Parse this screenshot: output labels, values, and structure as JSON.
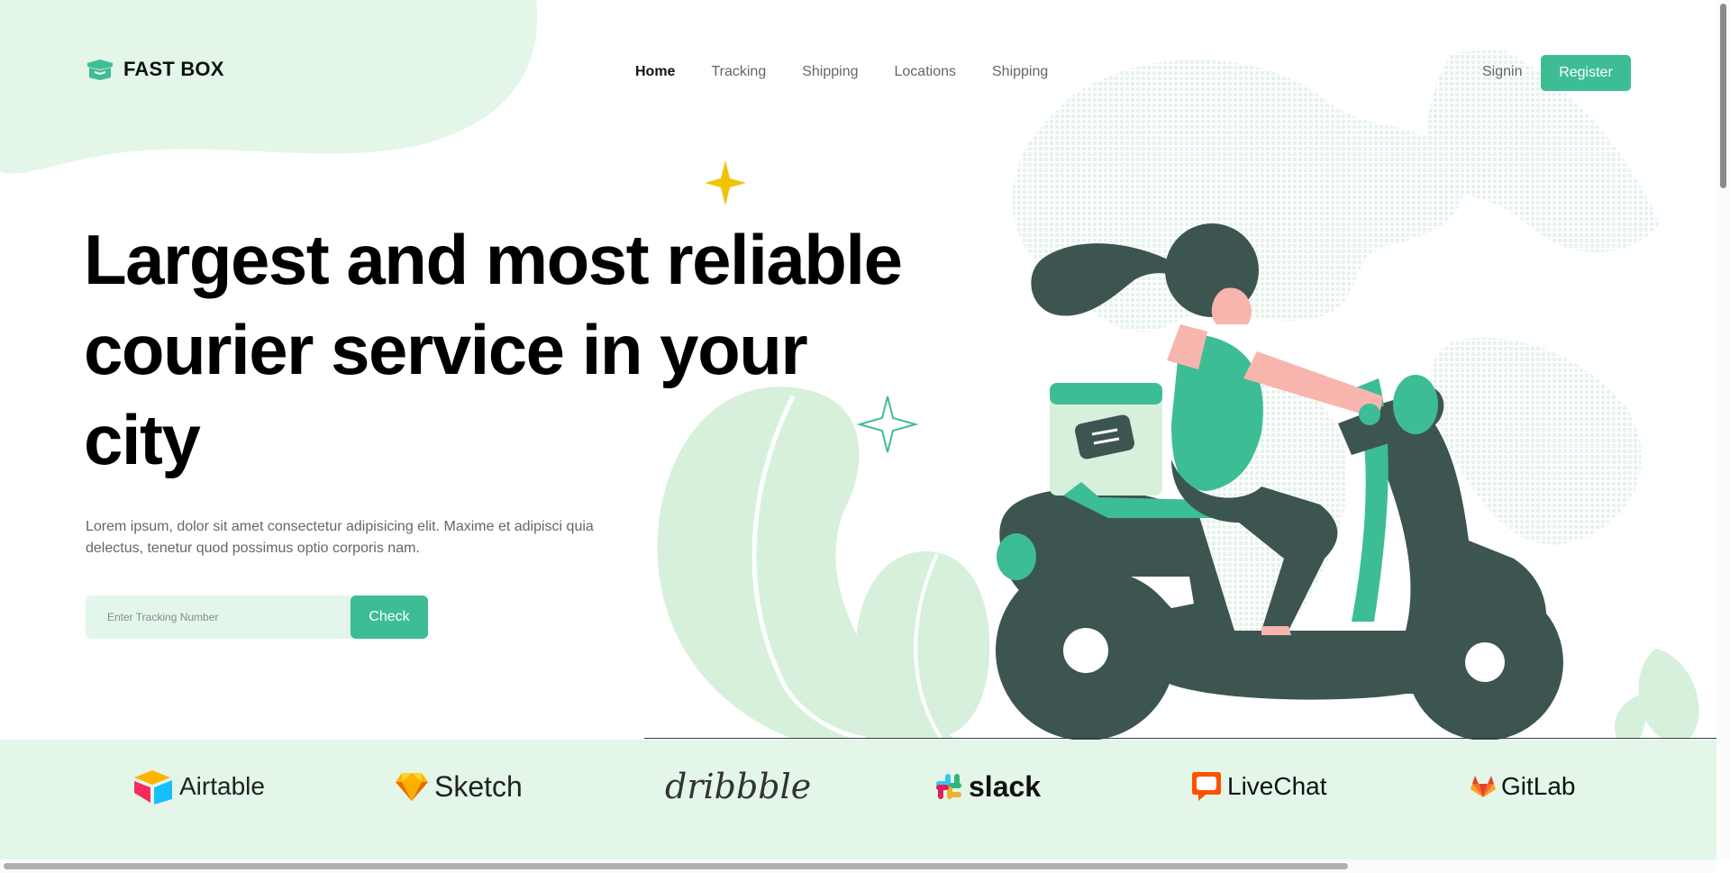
{
  "app": {
    "brand": "FAST BOX",
    "accent_color": "#3dbd95",
    "light_accent": "#e3f6e8",
    "dark_color": "#3d5550"
  },
  "nav": {
    "items": [
      {
        "label": "Home",
        "active": true
      },
      {
        "label": "Tracking",
        "active": false
      },
      {
        "label": "Shipping",
        "active": false
      },
      {
        "label": "Locations",
        "active": false
      },
      {
        "label": "Shipping",
        "active": false
      }
    ],
    "signin_label": "Signin",
    "register_label": "Register"
  },
  "hero": {
    "title_lines": [
      "Largest and most reliable",
      "courier service in your",
      "city"
    ],
    "description_lines": [
      "Lorem ipsum, dolor sit amet consectetur adipisicing elit. Maxime et adipisci quia",
      "delectus, tenetur quod possimus optio corporis nam."
    ],
    "tracking_placeholder": "Enter Tracking Number",
    "check_label": "Check"
  },
  "brands": [
    {
      "name": "Airtable",
      "icon": "airtable-logo"
    },
    {
      "name": "Sketch",
      "icon": "sketch-logo"
    },
    {
      "name": "dribbble",
      "icon": "dribbble-logo"
    },
    {
      "name": "slack",
      "icon": "slack-logo"
    },
    {
      "name": "LiveChat",
      "icon": "livechat-logo"
    },
    {
      "name": "GitLab",
      "icon": "gitlab-logo"
    }
  ]
}
